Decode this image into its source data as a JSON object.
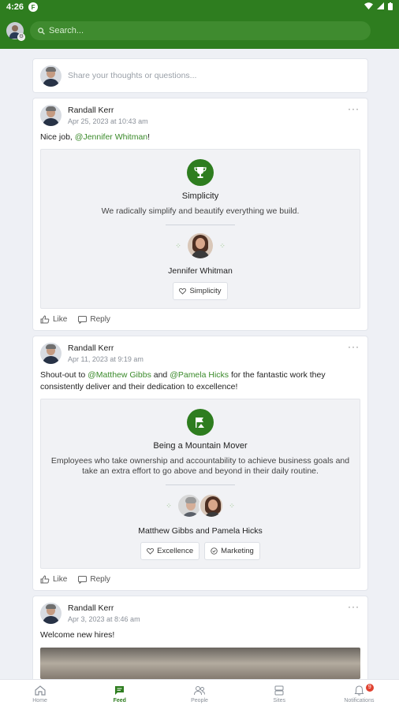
{
  "status_bar": {
    "time": "4:26",
    "app_icon": "F"
  },
  "header": {
    "search_placeholder": "Search..."
  },
  "composer": {
    "placeholder": "Share your thoughts or questions..."
  },
  "posts": [
    {
      "author": "Randall Kerr",
      "time": "Apr 25, 2023 at 10:43 am",
      "text_prefix": "Nice job, ",
      "mention1": "@Jennifer Whitman",
      "text_suffix": "!",
      "award": {
        "title": "Simplicity",
        "description": "We radically simplify and beautify everything we build.",
        "recipients": "Jennifer Whitman",
        "tags": [
          "Simplicity"
        ]
      },
      "like_label": "Like",
      "reply_label": "Reply"
    },
    {
      "author": "Randall Kerr",
      "time": "Apr 11, 2023 at 9:19 am",
      "text_prefix": "Shout-out to ",
      "mention1": "@Matthew Gibbs",
      "text_middle": " and ",
      "mention2": "@Pamela Hicks",
      "text_suffix": " for the fantastic work they consistently deliver and their dedication to excellence!",
      "award": {
        "title": "Being a Mountain Mover",
        "description": "Employees who take ownership and accountability to achieve business goals and take an extra effort to go above and beyond in their daily routine.",
        "recipients": "Matthew Gibbs and Pamela Hicks",
        "tags": [
          "Excellence",
          "Marketing"
        ]
      },
      "like_label": "Like",
      "reply_label": "Reply"
    },
    {
      "author": "Randall Kerr",
      "time": "Apr 3, 2023 at 8:46 am",
      "text": "Welcome new hires!"
    }
  ],
  "bottom_nav": {
    "items": [
      {
        "label": "Home",
        "icon": "home-icon"
      },
      {
        "label": "Feed",
        "icon": "feed-icon"
      },
      {
        "label": "People",
        "icon": "people-icon"
      },
      {
        "label": "Sites",
        "icon": "sites-icon"
      },
      {
        "label": "Notifications",
        "icon": "bell-icon"
      }
    ],
    "active": "Feed",
    "notification_count": "9"
  },
  "colors": {
    "brand": "#2e7d1f",
    "mention": "#3a8a2a",
    "badge": "#e0412f"
  }
}
